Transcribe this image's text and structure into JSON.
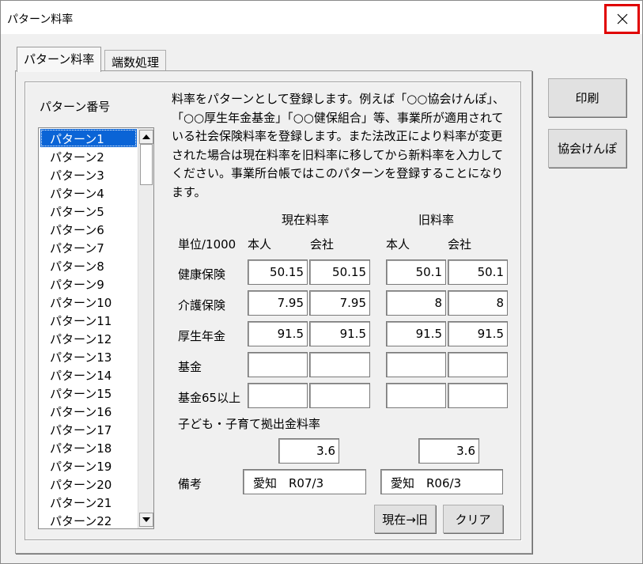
{
  "window": {
    "title": "パターン料率",
    "close_symbol": "✕"
  },
  "tabs": [
    {
      "label": "パターン料率",
      "active": true
    },
    {
      "label": "端数処理",
      "active": false
    }
  ],
  "list": {
    "title": "パターン番号",
    "items": [
      "パターン1",
      "パターン2",
      "パターン3",
      "パターン4",
      "パターン5",
      "パターン6",
      "パターン7",
      "パターン8",
      "パターン9",
      "パターン10",
      "パターン11",
      "パターン12",
      "パターン13",
      "パターン14",
      "パターン15",
      "パターン16",
      "パターン17",
      "パターン18",
      "パターン19",
      "パターン20",
      "パターン21",
      "パターン22"
    ],
    "selected_index": 0
  },
  "description": "料率をパターンとして登録します。例えば「○○協会けんぽ」、「○○厚生年金基金」「○○健保組合」等、事業所が適用されている社会保険料率を登録します。また法改正により料率が変更された場合は現在料率を旧料率に移してから新料率を入力してください。事業所台帳ではこのパターンを登録することになります。",
  "rates": {
    "current_header": "現在料率",
    "old_header": "旧料率",
    "unit_label": "単位/1000",
    "person_label": "本人",
    "company_label": "会社",
    "rows": [
      {
        "label": "健康保険",
        "cur_person": "50.15",
        "cur_company": "50.15",
        "old_person": "50.1",
        "old_company": "50.1"
      },
      {
        "label": "介護保険",
        "cur_person": "7.95",
        "cur_company": "7.95",
        "old_person": "8",
        "old_company": "8"
      },
      {
        "label": "厚生年金",
        "cur_person": "91.5",
        "cur_company": "91.5",
        "old_person": "91.5",
        "old_company": "91.5"
      },
      {
        "label": "基金",
        "cur_person": "",
        "cur_company": "",
        "old_person": "",
        "old_company": ""
      },
      {
        "label": "基金65以上",
        "cur_person": "",
        "cur_company": "",
        "old_person": "",
        "old_company": ""
      }
    ],
    "child_label": "子ども・子育て拠出金料率",
    "child_current": "3.6",
    "child_old": "3.6",
    "note_label": "備考",
    "note_current": "愛知　R07/3",
    "note_old": "愛知　R06/3"
  },
  "buttons": {
    "move": "現在→旧",
    "clear": "クリア",
    "print": "印刷",
    "kyokai": "協会けんぽ"
  }
}
